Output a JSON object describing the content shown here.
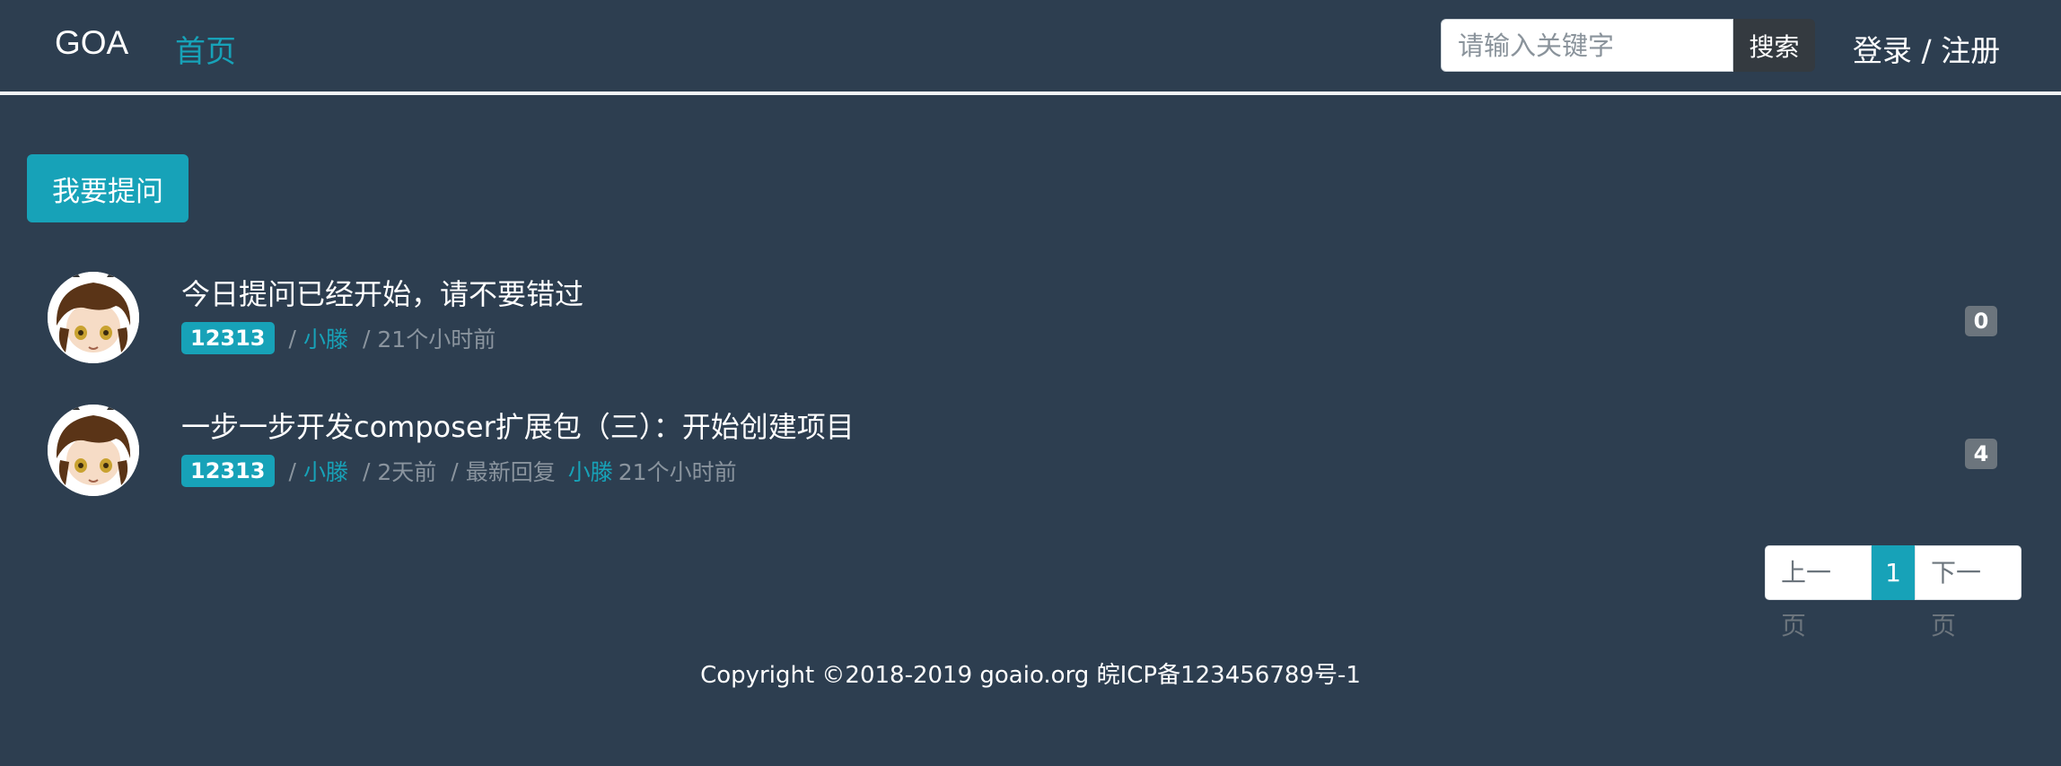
{
  "header": {
    "brand": "GOA",
    "nav_home": "首页",
    "search_placeholder": "请输入关键字",
    "search_button": "搜索",
    "auth": "登录 / 注册"
  },
  "main": {
    "ask_button": "我要提问",
    "posts": [
      {
        "title": "今日提问已经开始，请不要错过",
        "tag": "12313",
        "author": "小滕",
        "time": "21个小时前",
        "reply_count": "0"
      },
      {
        "title": "一步一步开发composer扩展包（三）：开始创建项目",
        "tag": "12313",
        "author": "小滕",
        "time": "2天前",
        "last_reply_label": "最新回复",
        "last_reply_user": "小滕",
        "last_reply_time": "21个小时前",
        "reply_count": "4"
      }
    ],
    "separator": "/"
  },
  "pagination": {
    "prev": "上一页",
    "current": "1",
    "next": "下一页"
  },
  "footer": {
    "copyright": "Copyright ©2018-2019 goaio.org 皖ICP备123456789号-1"
  },
  "colors": {
    "background": "#2d3e50",
    "accent": "#17a2b8",
    "badge": "#6c757d"
  }
}
